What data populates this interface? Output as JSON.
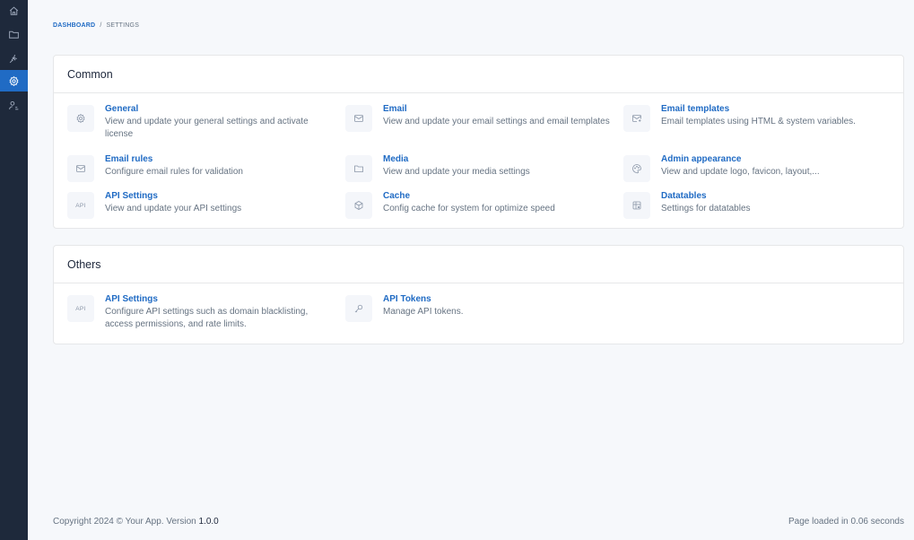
{
  "sidebar": {
    "items": [
      {
        "icon": "home-icon",
        "active": false
      },
      {
        "icon": "folder-icon",
        "active": false
      },
      {
        "icon": "plugin-icon",
        "active": false
      },
      {
        "icon": "settings-icon",
        "active": true
      },
      {
        "icon": "users-icon",
        "active": false
      }
    ]
  },
  "breadcrumb": {
    "dashboard": "DASHBOARD",
    "separator": "/",
    "current": "SETTINGS"
  },
  "common": {
    "title": "Common",
    "items": [
      {
        "icon": "gear-icon",
        "title": "General",
        "description": "View and update your general settings and activate license"
      },
      {
        "icon": "mail-icon",
        "title": "Email",
        "description": "View and update your email settings and email templates"
      },
      {
        "icon": "mail-template-icon",
        "title": "Email templates",
        "description": "Email templates using HTML & system variables."
      },
      {
        "icon": "mail-icon",
        "title": "Email rules",
        "description": "Configure email rules for validation"
      },
      {
        "icon": "folder-icon",
        "title": "Media",
        "description": "View and update your media settings"
      },
      {
        "icon": "palette-icon",
        "title": "Admin appearance",
        "description": "View and update logo, favicon, layout,..."
      },
      {
        "icon": "api-icon",
        "badge": "API",
        "title": "API Settings",
        "description": "View and update your API settings"
      },
      {
        "icon": "box-icon",
        "title": "Cache",
        "description": "Config cache for system for optimize speed"
      },
      {
        "icon": "table-icon",
        "title": "Datatables",
        "description": "Settings for datatables"
      }
    ]
  },
  "others": {
    "title": "Others",
    "items": [
      {
        "icon": "api-icon",
        "badge": "API",
        "title": "API Settings",
        "description": "Configure API settings such as domain blacklisting, access permissions, and rate limits."
      },
      {
        "icon": "key-icon",
        "title": "API Tokens",
        "description": "Manage API tokens."
      }
    ]
  },
  "footer": {
    "copyright": "Copyright 2024 © Your App. Version ",
    "version": "1.0.0",
    "page_loaded": "Page loaded in 0.06 seconds"
  },
  "colors": {
    "sidebar": "#1e293b",
    "accent": "#206bc4",
    "background": "#f6f8fb",
    "muted_text": "#667382"
  }
}
